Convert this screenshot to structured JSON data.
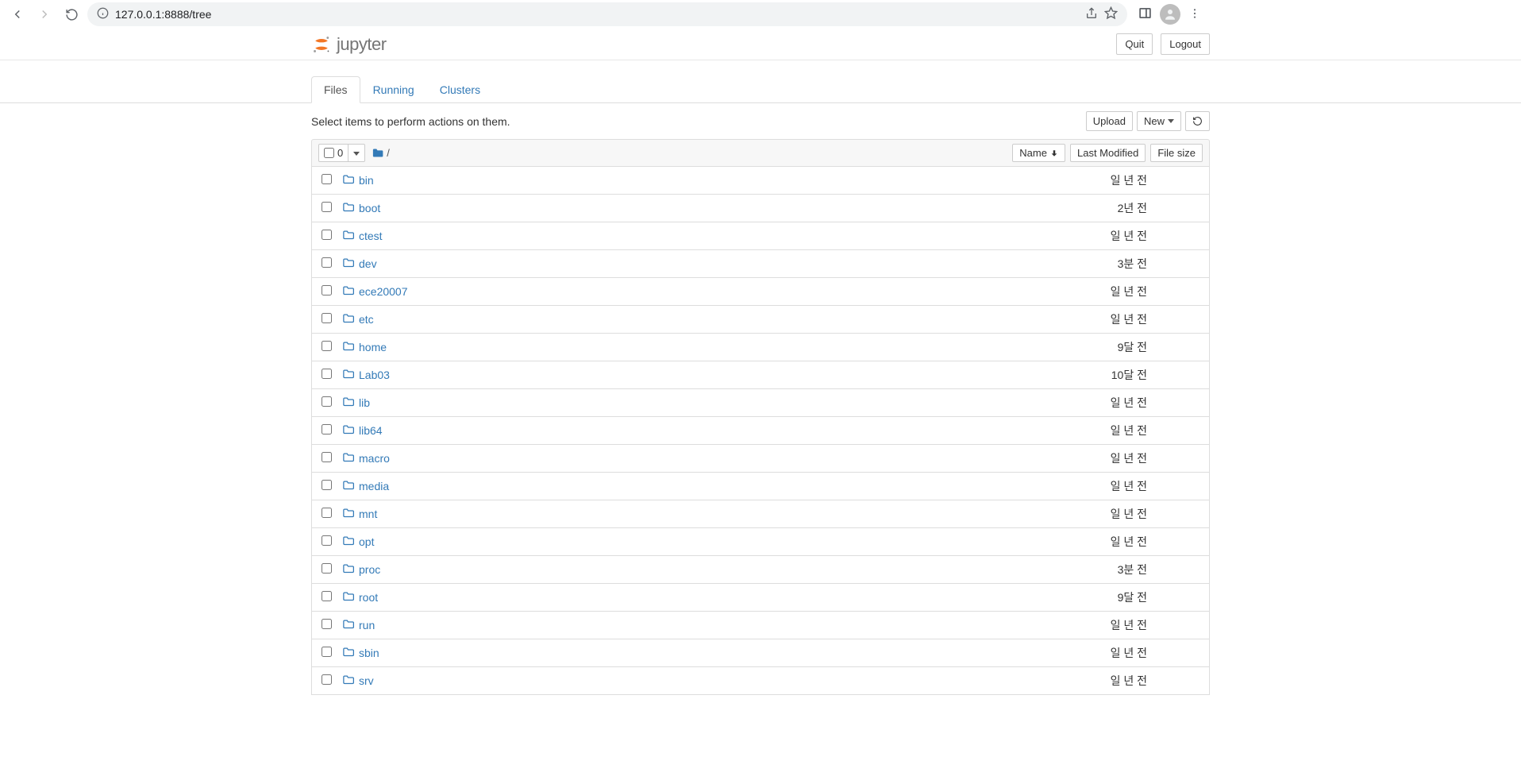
{
  "browser": {
    "url": "127.0.0.1:8888/tree"
  },
  "header": {
    "logo_text": "jupyter",
    "quit_label": "Quit",
    "logout_label": "Logout"
  },
  "tabs": [
    {
      "label": "Files",
      "active": true
    },
    {
      "label": "Running",
      "active": false
    },
    {
      "label": "Clusters",
      "active": false
    }
  ],
  "action_row": {
    "hint": "Select items to perform actions on them.",
    "upload_label": "Upload",
    "new_label": "New",
    "refresh_title": "Refresh"
  },
  "list_header": {
    "selected_count": "0",
    "breadcrumb_root": "/",
    "name_col": "Name",
    "modified_col": "Last Modified",
    "size_col": "File size"
  },
  "files": [
    {
      "name": "bin",
      "modified": "일 년 전",
      "size": ""
    },
    {
      "name": "boot",
      "modified": "2년 전",
      "size": ""
    },
    {
      "name": "ctest",
      "modified": "일 년 전",
      "size": ""
    },
    {
      "name": "dev",
      "modified": "3분 전",
      "size": ""
    },
    {
      "name": "ece20007",
      "modified": "일 년 전",
      "size": ""
    },
    {
      "name": "etc",
      "modified": "일 년 전",
      "size": ""
    },
    {
      "name": "home",
      "modified": "9달 전",
      "size": ""
    },
    {
      "name": "Lab03",
      "modified": "10달 전",
      "size": ""
    },
    {
      "name": "lib",
      "modified": "일 년 전",
      "size": ""
    },
    {
      "name": "lib64",
      "modified": "일 년 전",
      "size": ""
    },
    {
      "name": "macro",
      "modified": "일 년 전",
      "size": ""
    },
    {
      "name": "media",
      "modified": "일 년 전",
      "size": ""
    },
    {
      "name": "mnt",
      "modified": "일 년 전",
      "size": ""
    },
    {
      "name": "opt",
      "modified": "일 년 전",
      "size": ""
    },
    {
      "name": "proc",
      "modified": "3분 전",
      "size": ""
    },
    {
      "name": "root",
      "modified": "9달 전",
      "size": ""
    },
    {
      "name": "run",
      "modified": "일 년 전",
      "size": ""
    },
    {
      "name": "sbin",
      "modified": "일 년 전",
      "size": ""
    },
    {
      "name": "srv",
      "modified": "일 년 전",
      "size": ""
    }
  ]
}
